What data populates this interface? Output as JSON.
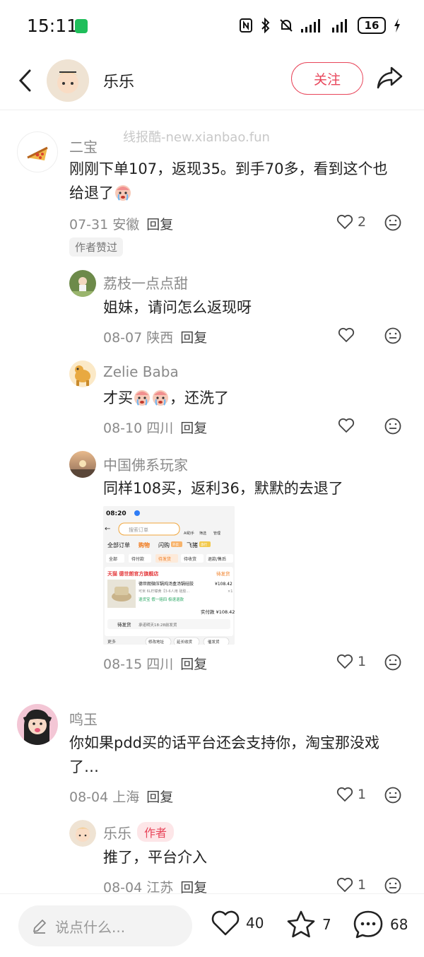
{
  "status_bar": {
    "time": "15:11",
    "battery": "16"
  },
  "header": {
    "name": "乐乐",
    "follow_label": "关注"
  },
  "watermark": "线报酷-new.xianbao.fun",
  "comments": [
    {
      "name": "二宝",
      "text": "刚刚下单107，返现35。到手70多，看到这个也给退了",
      "date_location": "07-31 安徽",
      "reply": "回复",
      "likes": "2",
      "badge": "作者赞过",
      "replies": [
        {
          "name": "荔枝一点点甜",
          "text": "姐妹，请问怎么返现呀",
          "date_location": "08-07 陕西",
          "reply": "回复",
          "likes": ""
        },
        {
          "name": "Zelie Baba",
          "text_a": "才买",
          "text_b": "，还洗了",
          "date_location": "08-10 四川",
          "reply": "回复",
          "likes": ""
        },
        {
          "name": "中国佛系玩家",
          "text": "同样108买，返利36，默默的去退了",
          "date_location": "08-15 四川",
          "reply": "回复",
          "likes": "1"
        }
      ]
    },
    {
      "name": "鸣玉",
      "text": "你如果pdd买的话平台还会支持你，淘宝那没戏了…",
      "date_location": "08-04 上海",
      "reply": "回复",
      "likes": "1",
      "replies": [
        {
          "name": "乐乐",
          "author_tag": "作者",
          "text": "推了，平台介入",
          "date_location": "08-04 江苏",
          "reply": "回复",
          "likes": "1"
        }
      ]
    }
  ],
  "screenshot": {
    "time": "08:20",
    "search_placeholder": "搜索订单",
    "icons": [
      "AI助手",
      "筛选",
      "管理"
    ],
    "tabs": [
      "全部订单",
      "购物",
      "闪购",
      "飞猪"
    ],
    "tab_badges": [
      "外卖",
      "旅行"
    ],
    "filters": [
      "全部",
      "待付款",
      "待发货",
      "待收货",
      "退款/售后"
    ],
    "shop": "天猫 德世朗官方旗舰店",
    "shop_status": "待发货",
    "product": "德世朗微压锅炖汤盒汤锅硅胶",
    "price": "¥108.42",
    "spec": "可米 6L柠檬黄【3-6人用 硅胶...",
    "qty": "×1",
    "service_tags": "退货宝 假一赔四 极速退款",
    "paid": "实付款 ¥108.42",
    "ship_status": "待发货",
    "ship_note": "承诺明天18:28前发货",
    "bottom": [
      "更多",
      "修改地址",
      "延长收货",
      "催发货"
    ]
  },
  "bottom_bar": {
    "placeholder": "说点什么...",
    "likes": "40",
    "favorites": "7",
    "comments": "68"
  }
}
